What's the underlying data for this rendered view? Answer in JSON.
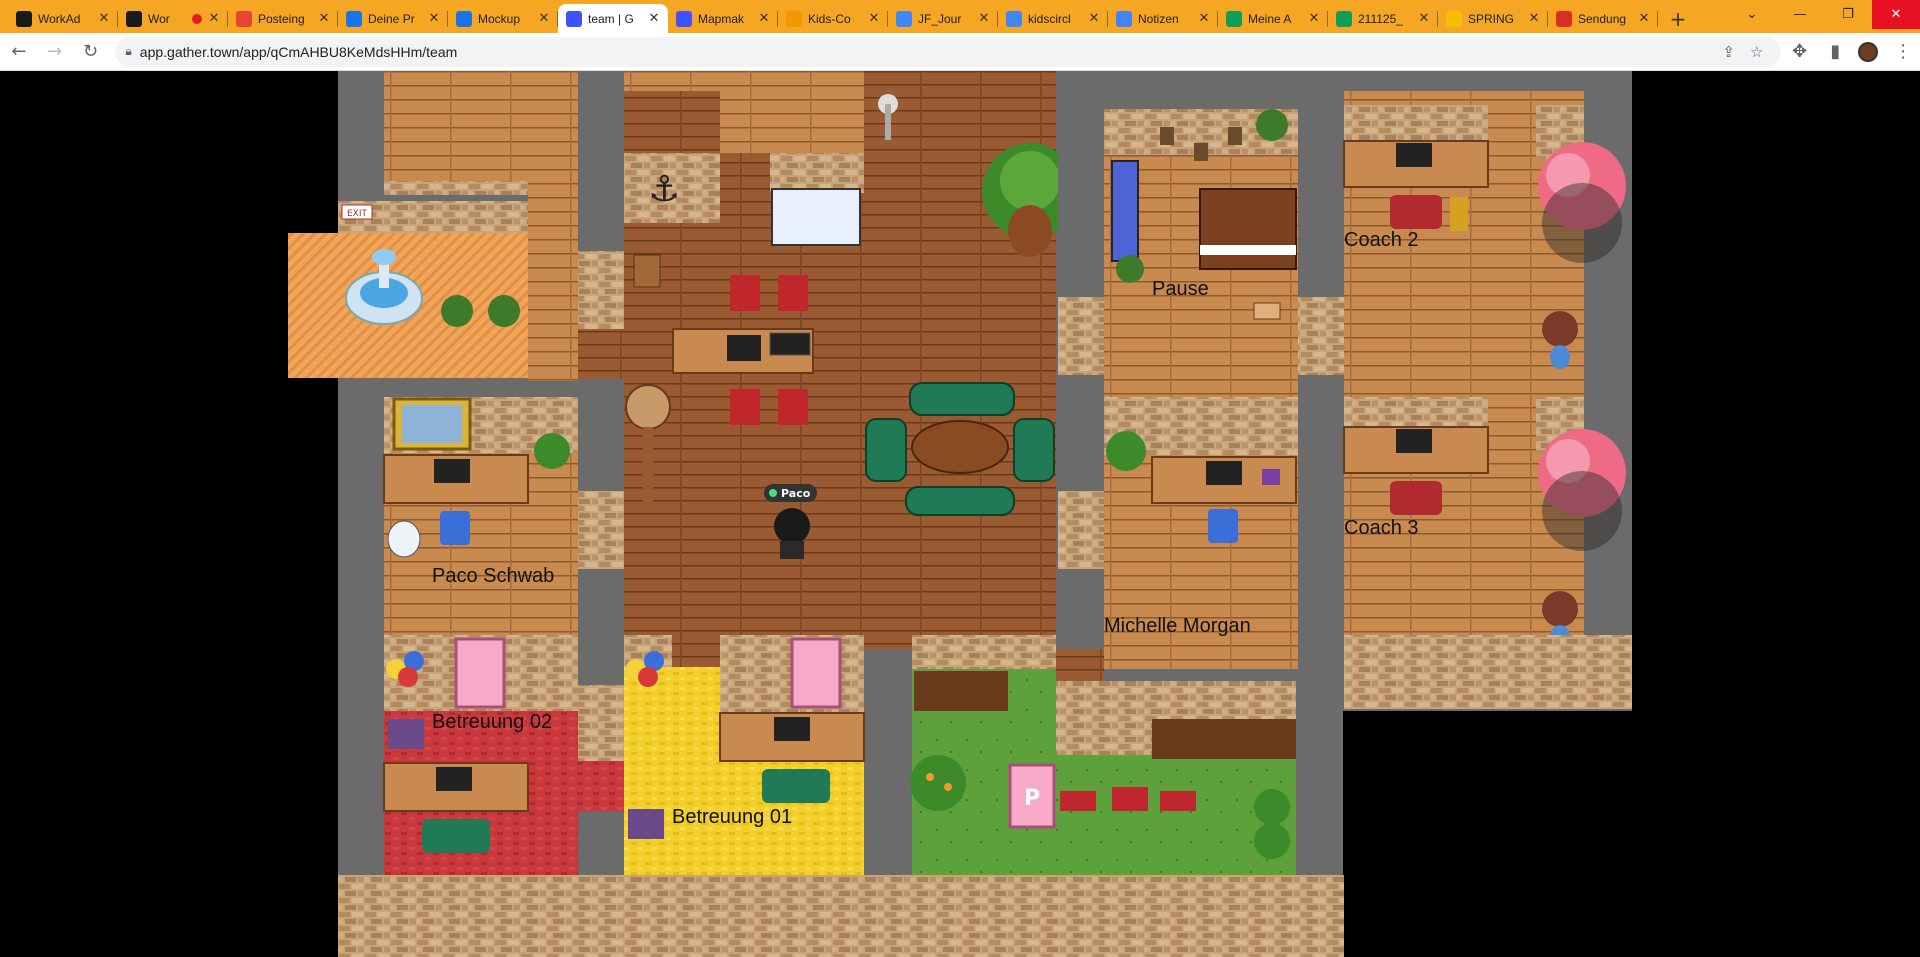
{
  "browser": {
    "tabs": [
      {
        "title": "WorkAd",
        "favicon_color": "#1a1a1a",
        "active": false
      },
      {
        "title": "Wor",
        "favicon_color": "#1a1a1a",
        "active": false,
        "recording": true
      },
      {
        "title": "Posteing",
        "favicon_color": "#ea4335",
        "active": false
      },
      {
        "title": "Deine Pr",
        "favicon_color": "#1a73e8",
        "active": false
      },
      {
        "title": "Mockup",
        "favicon_color": "#1a73e8",
        "active": false
      },
      {
        "title": "team | G",
        "favicon_color": "#4051ff",
        "active": true
      },
      {
        "title": "Mapmak",
        "favicon_color": "#4051ff",
        "active": false
      },
      {
        "title": "Kids-Co",
        "favicon_color": "#f29900",
        "active": false
      },
      {
        "title": "JF_Jour",
        "favicon_color": "#4285f4",
        "active": false
      },
      {
        "title": "kidscircl",
        "favicon_color": "#4285f4",
        "active": false
      },
      {
        "title": "Notizen",
        "favicon_color": "#4285f4",
        "active": false
      },
      {
        "title": "Meine A",
        "favicon_color": "#0f9d58",
        "active": false
      },
      {
        "title": "211125_",
        "favicon_color": "#0f9d58",
        "active": false
      },
      {
        "title": "SPRING",
        "favicon_color": "#fbbc04",
        "active": false
      },
      {
        "title": "Sendung",
        "favicon_color": "#d93025",
        "active": false
      }
    ],
    "url": "app.gather.town/app/qCmAHBU8KeMdsHHm/team"
  },
  "game": {
    "player_name": "Paco",
    "player_status_color": "#4ade80",
    "room_labels": [
      {
        "id": "coach2",
        "text": "Coach 2"
      },
      {
        "id": "pause",
        "text": "Pause"
      },
      {
        "id": "coach3",
        "text": "Coach 3"
      },
      {
        "id": "paco",
        "text": "Paco Schwab"
      },
      {
        "id": "michelle",
        "text": "Michelle Morgan"
      },
      {
        "id": "betreuung02",
        "text": "Betreuung 02"
      },
      {
        "id": "betreuung01",
        "text": "Betreuung 01"
      }
    ],
    "signs": {
      "exit": "EXIT",
      "parking": "P"
    }
  }
}
